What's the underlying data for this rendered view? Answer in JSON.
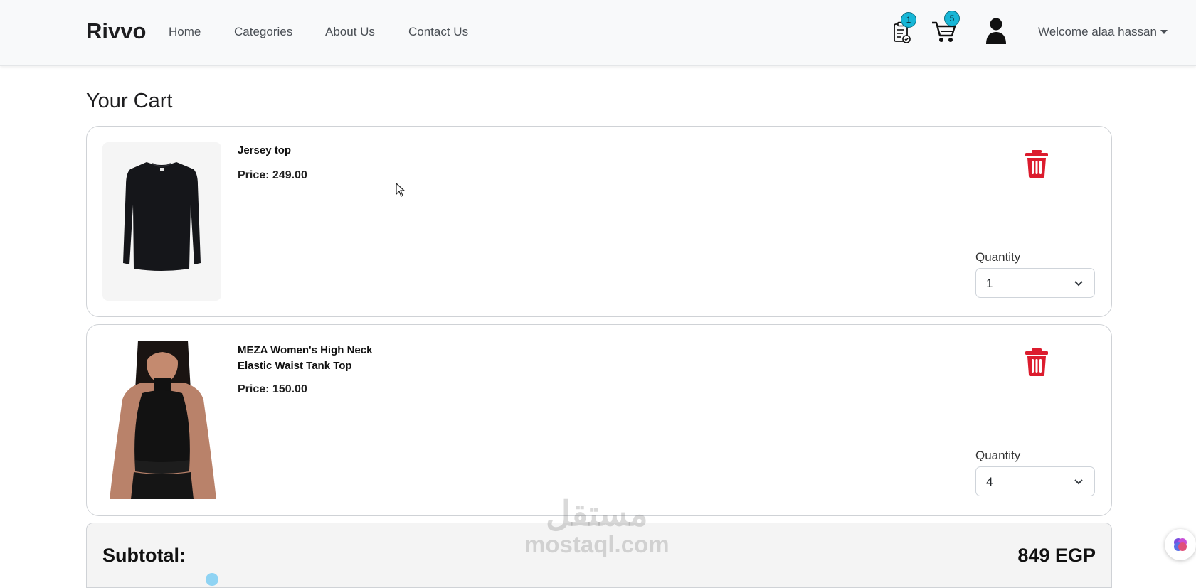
{
  "nav": {
    "brand": "Rivvo",
    "links": [
      "Home",
      "Categories",
      "About Us",
      "Contact Us"
    ],
    "orders_badge": "1",
    "cart_badge": "5",
    "welcome": "Welcome alaa hassan",
    "icons": [
      "orders-clipboard-icon",
      "cart-icon",
      "user-icon",
      "caret-down-icon"
    ]
  },
  "page": {
    "title": "Your Cart"
  },
  "cart": {
    "items": [
      {
        "name": "Jersey top",
        "price": "Price: 249.00",
        "quantity_label": "Quantity",
        "quantity": "1",
        "image": "black-long-sleeve-jersey-top"
      },
      {
        "name": "MEZA Women's High Neck Elastic Waist Tank Top",
        "price": "Price: 150.00",
        "quantity_label": "Quantity",
        "quantity": "4",
        "image": "woman-black-high-neck-tank-top"
      }
    ]
  },
  "summary": {
    "subtotal_label": "Subtotal:",
    "subtotal_value": "849 EGP"
  },
  "watermark": {
    "arabic": "مستقل",
    "latin": "mostaql.com"
  },
  "colors": {
    "navbar_bg": "#f8f9fa",
    "badge": "#17b6d6",
    "trash": "#dc1c2e",
    "summary_bg": "#f4f4f4"
  }
}
